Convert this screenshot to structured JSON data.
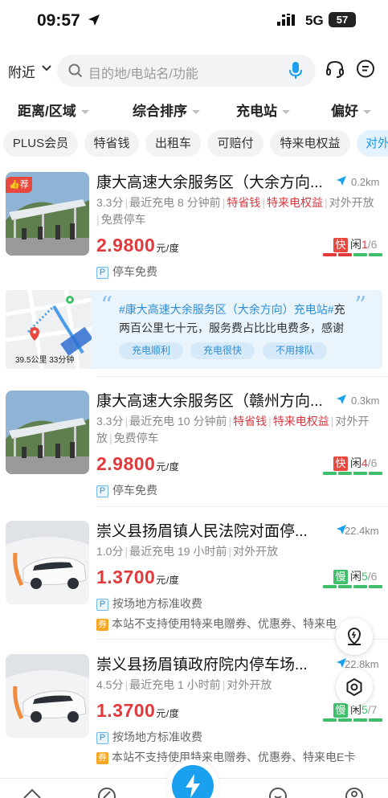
{
  "status_bar": {
    "time": "09:57",
    "network": "5G",
    "battery": "57"
  },
  "search": {
    "city": "附近",
    "placeholder": "目的地/电站名/功能"
  },
  "filters": [
    "距离/区域",
    "综合排序",
    "充电站",
    "偏好"
  ],
  "chips": [
    "PLUS会员",
    "特省钱",
    "出租车",
    "可赔付",
    "特来电权益",
    "对外"
  ],
  "stations": [
    {
      "badge": "荐",
      "name": "康大高速大余服务区（大余方向...",
      "distance": "0.2km",
      "score": "3.3分",
      "last_charge": "最近充电 8 分钟前",
      "tag1": "特省钱",
      "tag2": "特来电权益",
      "meta_rest": "对外开放",
      "meta_rest2": "免费停车",
      "price": "2.9800",
      "unit": "元/度",
      "avail_type": "快",
      "avail_label": "闲",
      "avail_free": "1",
      "avail_total": "/6",
      "free_fraction": 0.167,
      "parking": "停车免费"
    },
    {
      "name": "康大高速大余服务区（赣州方向...",
      "distance": "0.3km",
      "score": "3.3分",
      "last_charge": "最近充电 10 分钟前",
      "tag1": "特省钱",
      "tag2": "特来电权益",
      "meta_rest": "对外开",
      "meta_rest2": "放",
      "meta_rest3": "免费停车",
      "price": "2.9800",
      "unit": "元/度",
      "avail_type": "快",
      "avail_label": "闲",
      "avail_free": "4",
      "avail_total": "/6",
      "free_fraction": 0.667,
      "parking": "停车免费"
    },
    {
      "name": "崇义县扬眉镇人民法院对面停...",
      "distance": "22.4km",
      "score": "1.0分",
      "last_charge": "最近充电 19 小时前",
      "meta_rest": "对外开放",
      "price": "1.3700",
      "unit": "元/度",
      "avail_type": "慢",
      "avail_label": "闲",
      "avail_free": "5",
      "avail_total": "/6",
      "free_fraction": 0.833,
      "parking": "按场地方标准收费",
      "coupon_icon": "券",
      "coupon": "本站不支持使用特来电赠券、优惠券、特来电"
    },
    {
      "name": "崇义县扬眉镇政府院内停车场...",
      "distance": "22.8km",
      "score": "4.5分",
      "last_charge": "最近充电 1 小时前",
      "meta_rest": "对外开放",
      "price": "1.3700",
      "unit": "元/度",
      "avail_type": "慢",
      "avail_label": "闲",
      "avail_free": "5",
      "avail_total": "/7",
      "free_fraction": 0.714,
      "parking": "按场地方标准收费",
      "coupon_icon": "券",
      "coupon": "本站不支持使用特来电赠券、优惠券、特来电E卡"
    }
  ],
  "comment": {
    "map_label": "39.5公里 33分钟",
    "hashtag": "#康大高速大余服务区（大余方向）充电站#",
    "text": "充两百公里七十元，服务费占比比电费多，感谢",
    "tags": [
      "充电顺利",
      "充电很快",
      "不用排队"
    ]
  },
  "colors": {
    "accent": "#1aa0ef",
    "price_red": "#e4393c",
    "free_green": "#3fbf6a",
    "fast_red": "#e8483e"
  },
  "icons": [
    "location-arrow-icon",
    "signal-icon",
    "chevron-down-icon",
    "search-icon",
    "mic-icon",
    "headset-icon",
    "chat-icon",
    "navigate-arrow-icon",
    "map-pin-icon",
    "settings-icon",
    "lightning-icon",
    "home-icon",
    "discover-icon",
    "message-icon",
    "profile-icon"
  ]
}
